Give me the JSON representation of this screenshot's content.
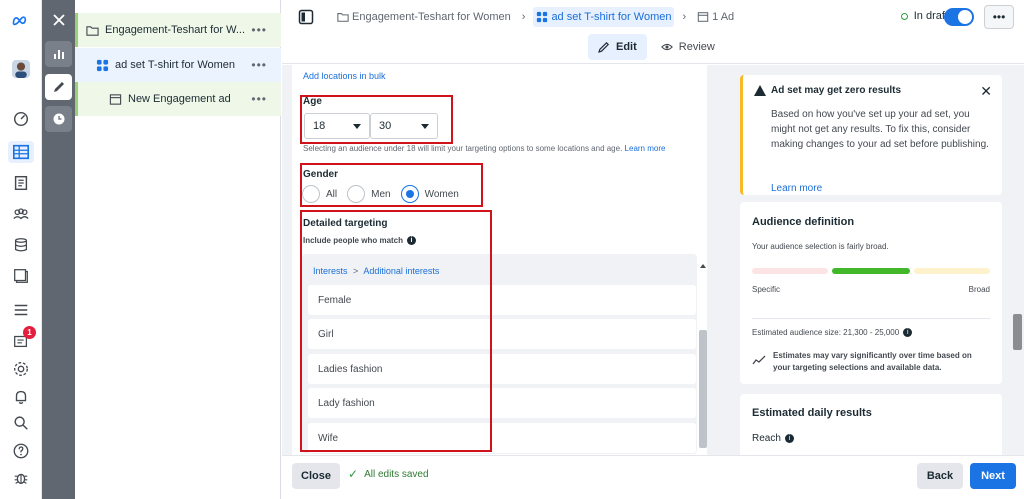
{
  "rail": {
    "notification_count": "1"
  },
  "tree": {
    "campaign": "Engagement-Teshart for W...",
    "adset": "ad set T-shirt for Women",
    "ad": "New Engagement ad",
    "more": "•••"
  },
  "header": {
    "crumb_campaign": "Engagement-Teshart for Women",
    "crumb_adset": "ad set T-shirt for Women",
    "crumb_ad": "1 Ad",
    "status": "In draft",
    "more": "•••",
    "mode_edit": "Edit",
    "mode_review": "Review"
  },
  "form": {
    "bulk_link": "Add locations in bulk",
    "age_label": "Age",
    "age_min": "18",
    "age_max": "30",
    "age_hint": "Selecting an audience under 18 will limit your targeting options to some locations and age.",
    "age_hint_link": "Learn more",
    "gender_label": "Gender",
    "gender_options": [
      "All",
      "Men",
      "Women"
    ],
    "gender_selected": "Women",
    "detailed_label": "Detailed targeting",
    "include_label": "Include people who match",
    "interest_path_1": "Interests",
    "interest_path_sep": ">",
    "interest_path_2": "Additional interests",
    "interests": [
      "Female",
      "Girl",
      "Ladies fashion",
      "Lady fashion",
      "Wife"
    ]
  },
  "footer": {
    "close": "Close",
    "saved": "All edits saved",
    "back": "Back",
    "next": "Next"
  },
  "right": {
    "warn_title": "Ad set may get zero results",
    "warn_body": "Based on how you've set up your ad set, you might not get any results. To fix this, consider making changes to your ad set before publishing.",
    "warn_link": "Learn more",
    "aud_title": "Audience definition",
    "aud_desc": "Your audience selection is fairly broad.",
    "aud_specific": "Specific",
    "aud_broad": "Broad",
    "aud_size": "Estimated audience size: 21,300 - 25,000",
    "aud_note": "Estimates may vary significantly over time based on your targeting selections and available data.",
    "daily_title": "Estimated daily results",
    "reach": "Reach"
  },
  "colors": {
    "accent": "#1b74e4",
    "highlight": "#d0131b",
    "warning": "#f7b928",
    "meter_green": "#42b72a"
  }
}
